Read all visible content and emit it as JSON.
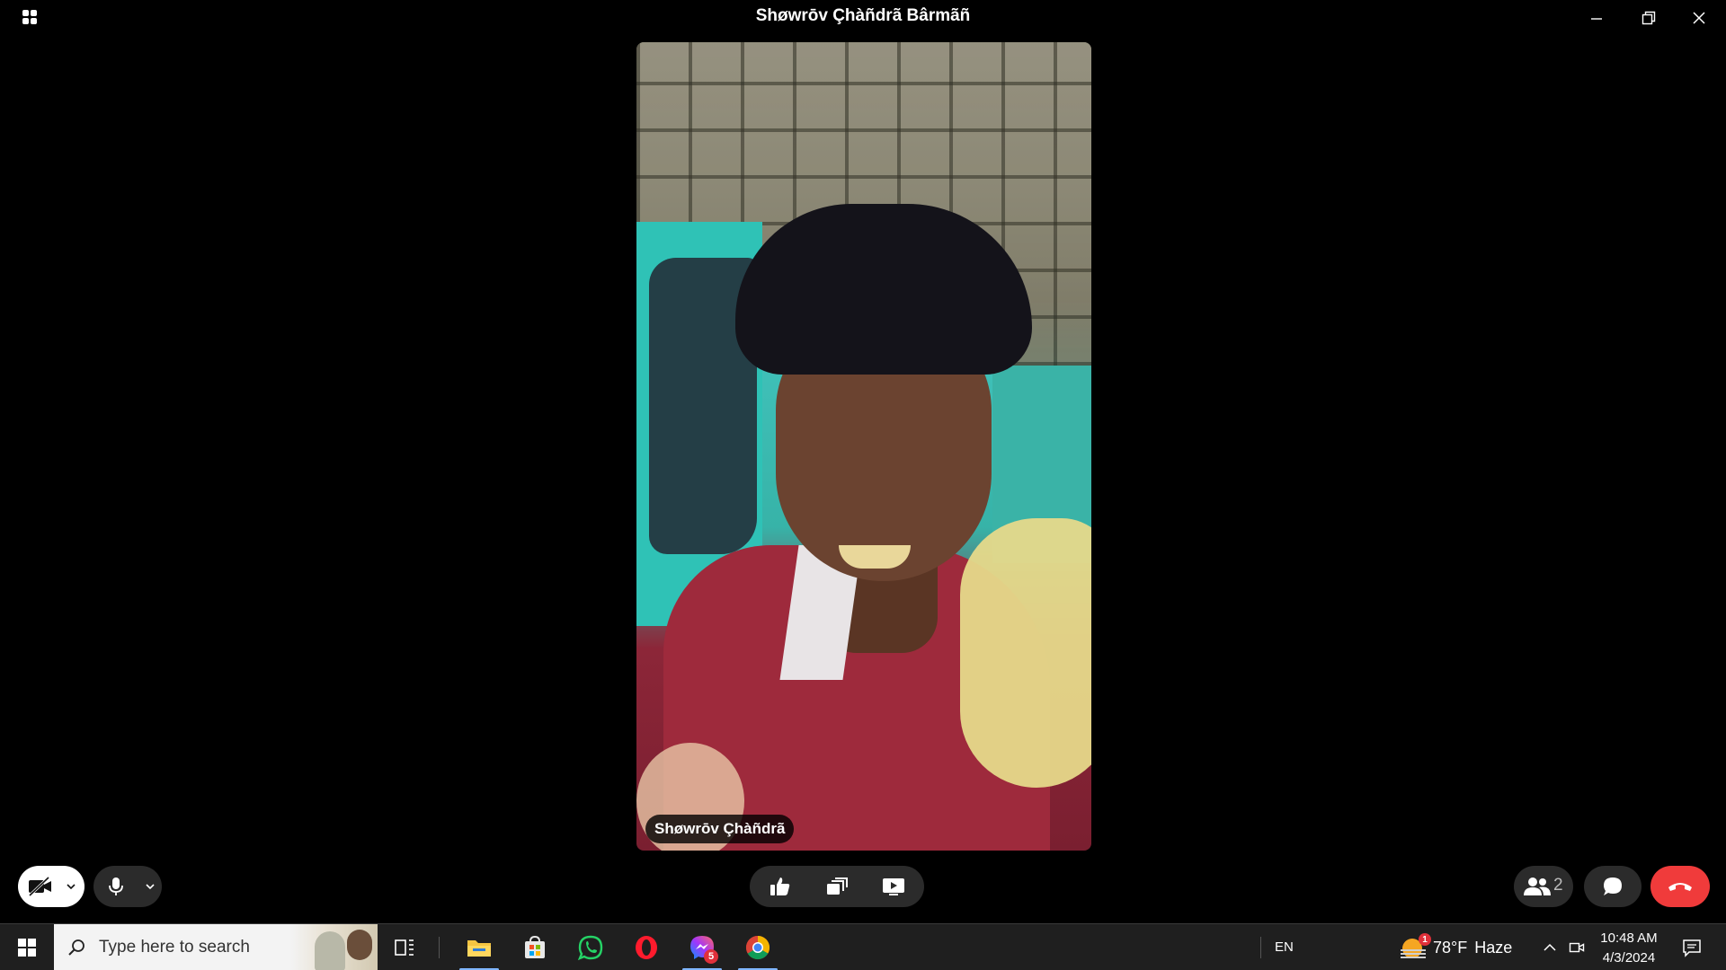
{
  "window": {
    "title": "Shøwrōv Çhàñdrã Bârmãñ",
    "controls": [
      "minimize-icon",
      "restore-icon",
      "close-icon"
    ]
  },
  "video": {
    "participant_label": "Shøwrōv Çhàñdrã"
  },
  "call_controls": {
    "camera": {
      "icon": "camera-off-icon",
      "state": "off"
    },
    "microphone": {
      "icon": "microphone-icon",
      "state": "on"
    },
    "center": [
      "like-reaction-icon",
      "switch-camera-icon",
      "share-screen-icon"
    ],
    "participants_count": "2",
    "chat": {
      "icon": "chat-icon"
    },
    "end_call": {
      "icon": "end-call-icon",
      "color": "#f03b3b"
    }
  },
  "taskbar": {
    "search_placeholder": "Type here to search",
    "apps": [
      {
        "name": "file-explorer",
        "icon": "folder-icon",
        "active": true
      },
      {
        "name": "microsoft-store",
        "icon": "store-icon",
        "active": false
      },
      {
        "name": "whatsapp",
        "icon": "whatsapp-icon",
        "active": false
      },
      {
        "name": "opera",
        "icon": "opera-icon",
        "active": false
      },
      {
        "name": "messenger",
        "icon": "messenger-icon",
        "active": true,
        "badge": "5"
      },
      {
        "name": "chrome",
        "icon": "chrome-icon",
        "active": true
      }
    ],
    "language": "EN",
    "weather": {
      "temperature": "78°F",
      "condition": "Haze",
      "alert_count": "1"
    },
    "time": "10:48 AM",
    "date": "4/3/2024"
  }
}
